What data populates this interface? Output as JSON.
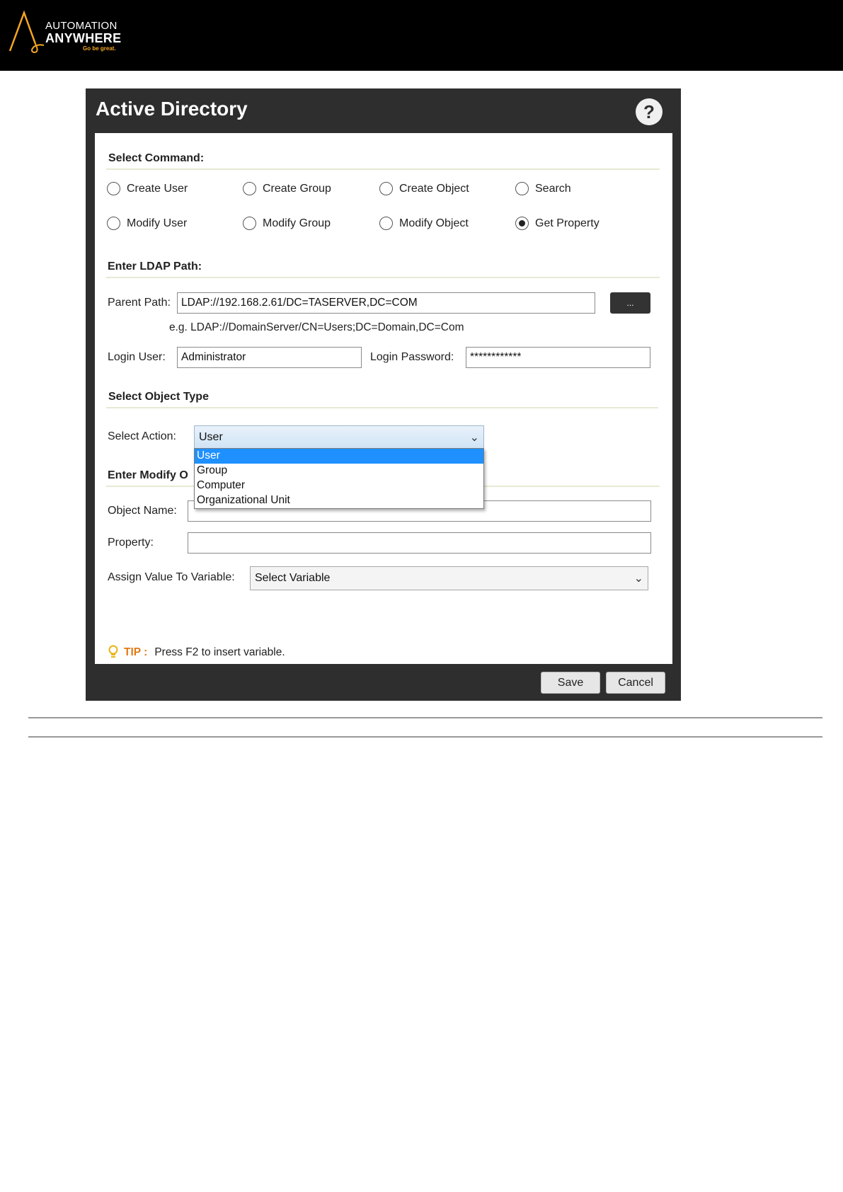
{
  "brand": {
    "line1": "AUTOMATION",
    "line2": "ANYWHERE",
    "tagline": "Go be great."
  },
  "dialog": {
    "title": "Active Directory",
    "help_symbol": "?"
  },
  "select_command": {
    "title": "Select Command:",
    "options": [
      {
        "label": "Create User",
        "selected": false
      },
      {
        "label": "Create Group",
        "selected": false
      },
      {
        "label": "Create Object",
        "selected": false
      },
      {
        "label": "Search",
        "selected": false
      },
      {
        "label": "Modify User",
        "selected": false
      },
      {
        "label": "Modify Group",
        "selected": false
      },
      {
        "label": "Modify Object",
        "selected": false
      },
      {
        "label": "Get Property",
        "selected": true
      }
    ]
  },
  "ldap": {
    "title": "Enter LDAP Path:",
    "parent_path_label": "Parent Path:",
    "parent_path_value": "LDAP://192.168.2.61/DC=TASERVER,DC=COM",
    "browse_label": "...",
    "example": "e.g. LDAP://DomainServer/CN=Users;DC=Domain,DC=Com",
    "login_user_label": "Login User:",
    "login_user_value": "Administrator",
    "login_password_label": "Login Password:",
    "login_password_value": "************"
  },
  "object_type": {
    "title": "Select Object Type",
    "action_label": "Select Action:",
    "action_value": "User",
    "options": [
      "User",
      "Group",
      "Computer",
      "Organizational Unit"
    ],
    "highlighted_index": 0
  },
  "modify": {
    "title_visible": "Enter Modify O",
    "object_name_label": "Object Name:",
    "object_name_value": "",
    "property_label": "Property:",
    "property_value": "",
    "assign_label": "Assign Value To Variable:",
    "assign_value": "Select Variable"
  },
  "tip": {
    "label": "TIP :",
    "text": "Press F2 to insert variable."
  },
  "buttons": {
    "save": "Save",
    "cancel": "Cancel"
  },
  "colors": {
    "header_bg": "#000000",
    "dialog_bg": "#2e2e2e",
    "tip_accent": "#e07b17",
    "dropdown_highlight": "#1e90ff",
    "brand_accent": "#f5a623"
  }
}
